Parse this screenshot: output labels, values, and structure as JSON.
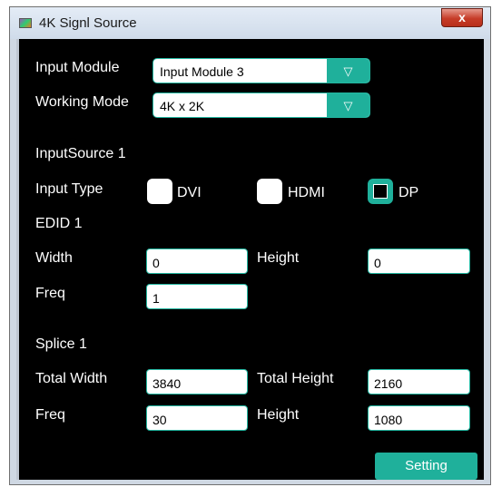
{
  "window": {
    "title": "4K Signl Source",
    "close_label": "x"
  },
  "input_module": {
    "label": "Input Module",
    "value": "Input Module 3",
    "arrow": "▽"
  },
  "working_mode": {
    "label": "Working Mode",
    "value": "4K x 2K",
    "arrow": "▽"
  },
  "input_source": {
    "heading": "InputSource 1",
    "type_label": "Input Type",
    "types": [
      {
        "label": "DVI",
        "checked": false
      },
      {
        "label": "HDMI",
        "checked": false
      },
      {
        "label": "DP",
        "checked": true
      }
    ]
  },
  "edid": {
    "heading": "EDID 1",
    "width_label": "Width",
    "width_value": "0",
    "height_label": "Height",
    "height_value": "0",
    "freq_label": "Freq",
    "freq_value": "1"
  },
  "splice": {
    "heading": "Splice 1",
    "total_width_label": "Total Width",
    "total_width_value": "3840",
    "total_height_label": "Total Height",
    "total_height_value": "2160",
    "freq_label": "Freq",
    "freq_value": "30",
    "height_label": "Height",
    "height_value": "1080"
  },
  "setting_button": "Setting",
  "colors": {
    "accent": "#1fb09b",
    "panel_bg": "#000000",
    "close_red": "#c63c28"
  }
}
